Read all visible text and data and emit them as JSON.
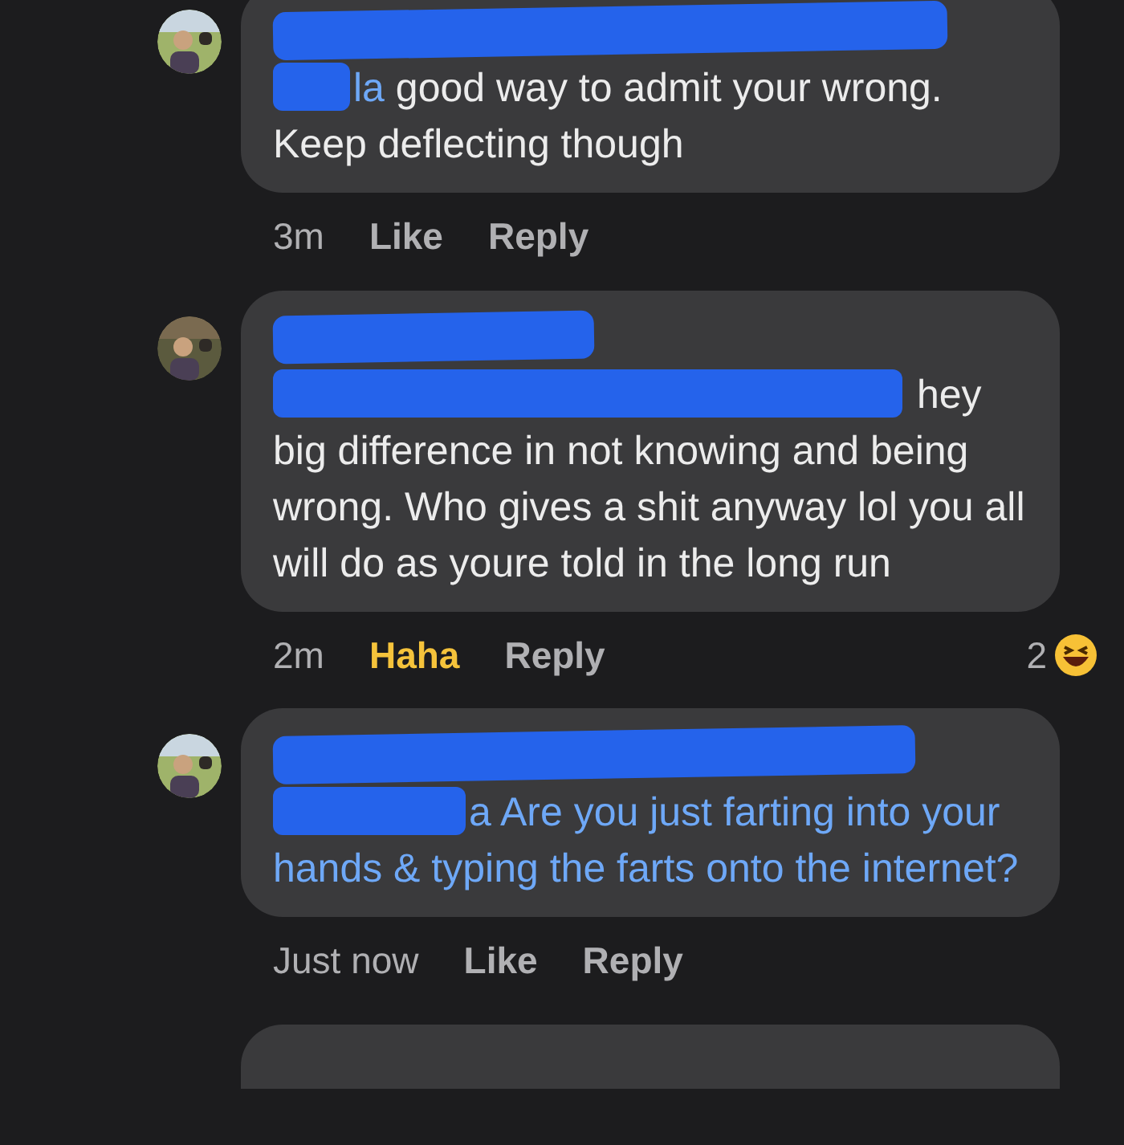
{
  "comments": [
    {
      "mention_tail": "la",
      "text": "good way to admit your wrong. Keep deflecting though",
      "is_link": false,
      "time": "3m",
      "actions": [
        {
          "label": "Like",
          "selected": false
        },
        {
          "label": "Reply",
          "selected": false
        }
      ]
    },
    {
      "text": "hey big difference in not knowing and being wrong. Who gives a shit anyway lol you all will do as youre told in the long run",
      "is_link": false,
      "time": "2m",
      "actions": [
        {
          "label": "Haha",
          "selected": true
        },
        {
          "label": "Reply",
          "selected": false
        }
      ],
      "reaction_count": "2"
    },
    {
      "mention_tail": "a",
      "text": "Are you just farting into your hands & typing the farts onto the internet?",
      "is_link": true,
      "time": "Just now",
      "actions": [
        {
          "label": "Like",
          "selected": false
        },
        {
          "label": "Reply",
          "selected": false
        }
      ]
    }
  ]
}
